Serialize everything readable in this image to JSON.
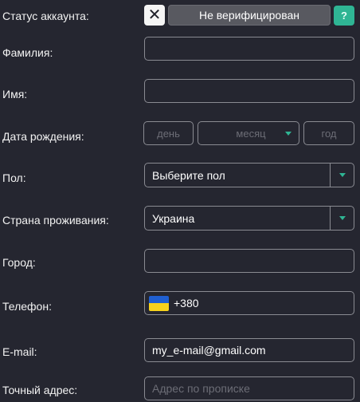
{
  "status": {
    "label": "Статус аккаунта:",
    "badge": "Не верифицирован",
    "help": "?"
  },
  "fields": {
    "surname_label": "Фамилия:",
    "name_label": "Имя:",
    "birth_label": "Дата рождения:",
    "birth_day_placeholder": "день",
    "birth_month_placeholder": "месяц",
    "birth_year_placeholder": "год",
    "gender_label": "Пол:",
    "gender_value": "Выберите пол",
    "country_label": "Страна проживания:",
    "country_value": "Украина",
    "city_label": "Город:",
    "phone_label": "Телефон:",
    "phone_value": "+380",
    "email_label": "E-mail:",
    "email_value": "my_e-mail@gmail.com",
    "address_label": "Точный адрес:",
    "address_placeholder": "Адрес по прописке"
  },
  "colors": {
    "background": "#252630",
    "accent": "#2fb594",
    "badge_bg": "#585960",
    "field_border": "#8a8b92"
  },
  "icons": {
    "status": "close-icon",
    "help": "question-icon",
    "select": "caret-down-icon",
    "phone_flag": "ukraine-flag-icon"
  }
}
